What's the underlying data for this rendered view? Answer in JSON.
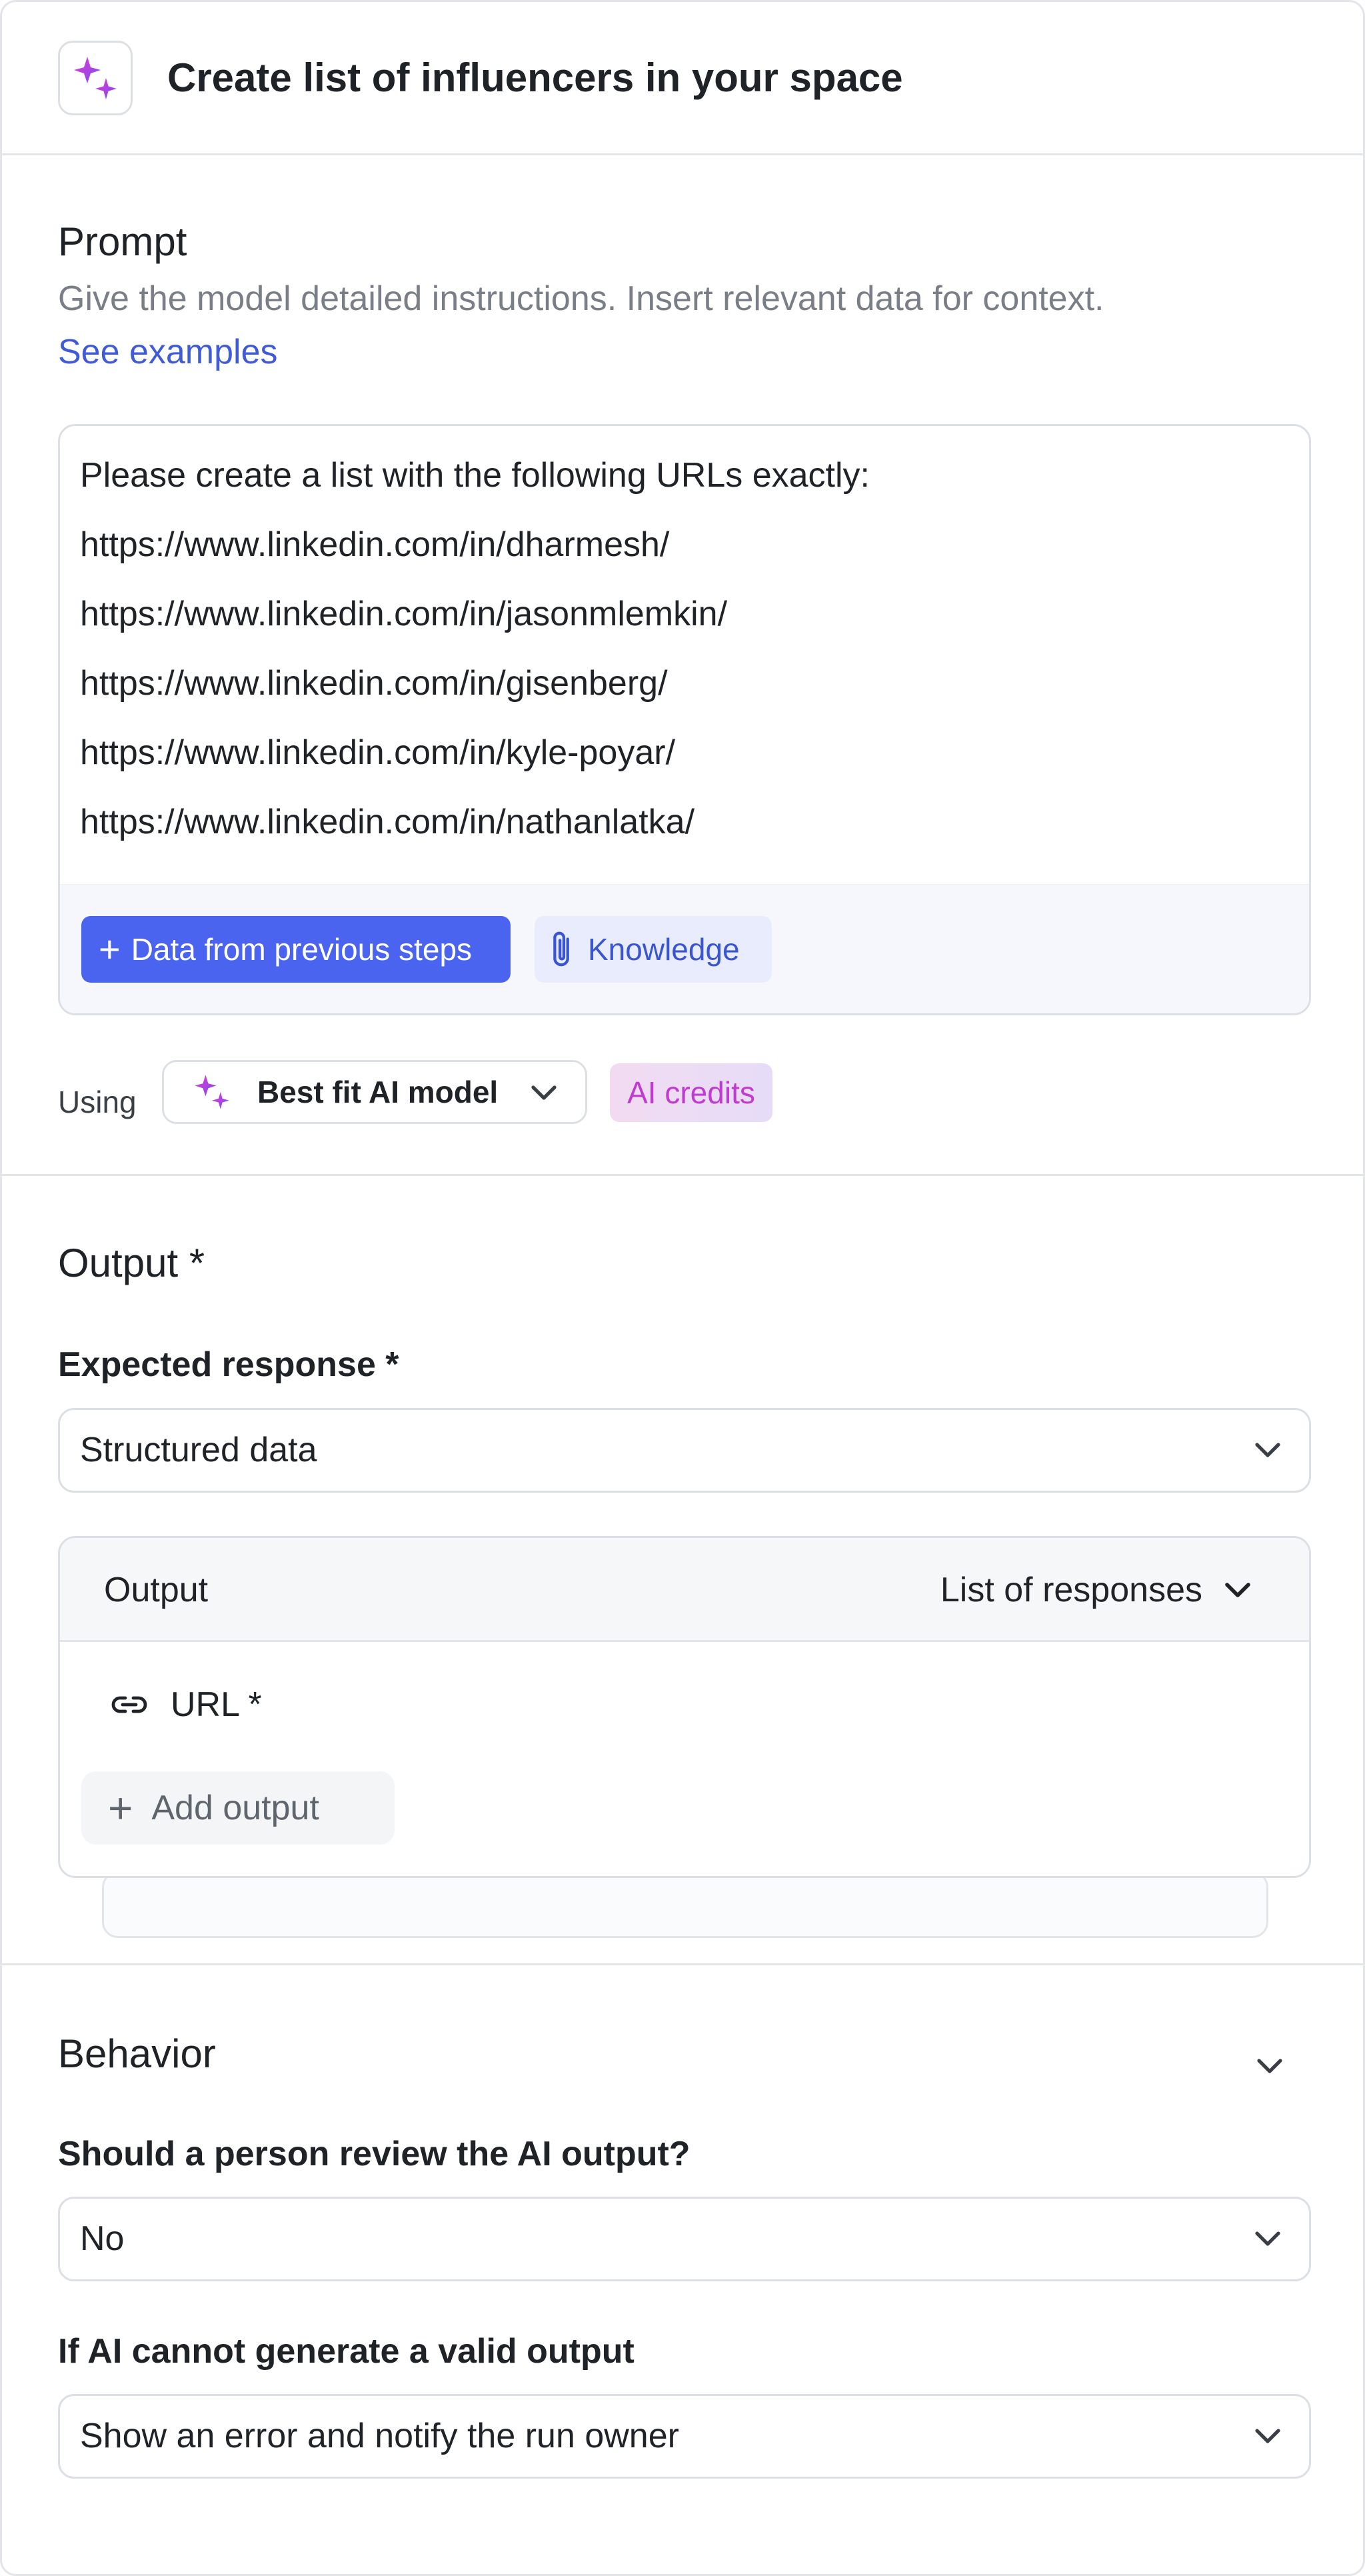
{
  "header": {
    "title": "Create list of influencers in your space",
    "icon": "sparkle-icon"
  },
  "prompt": {
    "heading": "Prompt",
    "description": "Give the model detailed instructions. Insert relevant data for context.",
    "examples_link": "See examples",
    "lines": [
      "Please create a list with the following URLs exactly:",
      "https://www.linkedin.com/in/dharmesh/",
      "https://www.linkedin.com/in/jasonmlemkin/",
      "https://www.linkedin.com/in/gisenberg/",
      "https://www.linkedin.com/in/kyle-poyar/",
      "https://www.linkedin.com/in/nathanlatka/"
    ],
    "data_button": "Data from previous steps",
    "knowledge_button": "Knowledge",
    "using_label": "Using",
    "model_select": "Best fit AI model",
    "credits_badge": "AI credits"
  },
  "output": {
    "heading": "Output *",
    "expected_label": "Expected response *",
    "expected_value": "Structured data",
    "card_title": "Output",
    "card_mode": "List of responses",
    "field_name": "URL *",
    "add_output": "Add output"
  },
  "behavior": {
    "heading": "Behavior",
    "review_label": "Should a person review the AI output?",
    "review_value": "No",
    "fallback_label": "If AI cannot generate a valid output",
    "fallback_value": "Show an error and notify the run owner"
  },
  "colors": {
    "accent": "#4a64f0",
    "link": "#3f5bd8",
    "border": "#dcdfe4",
    "credits": "#c03bd0"
  }
}
